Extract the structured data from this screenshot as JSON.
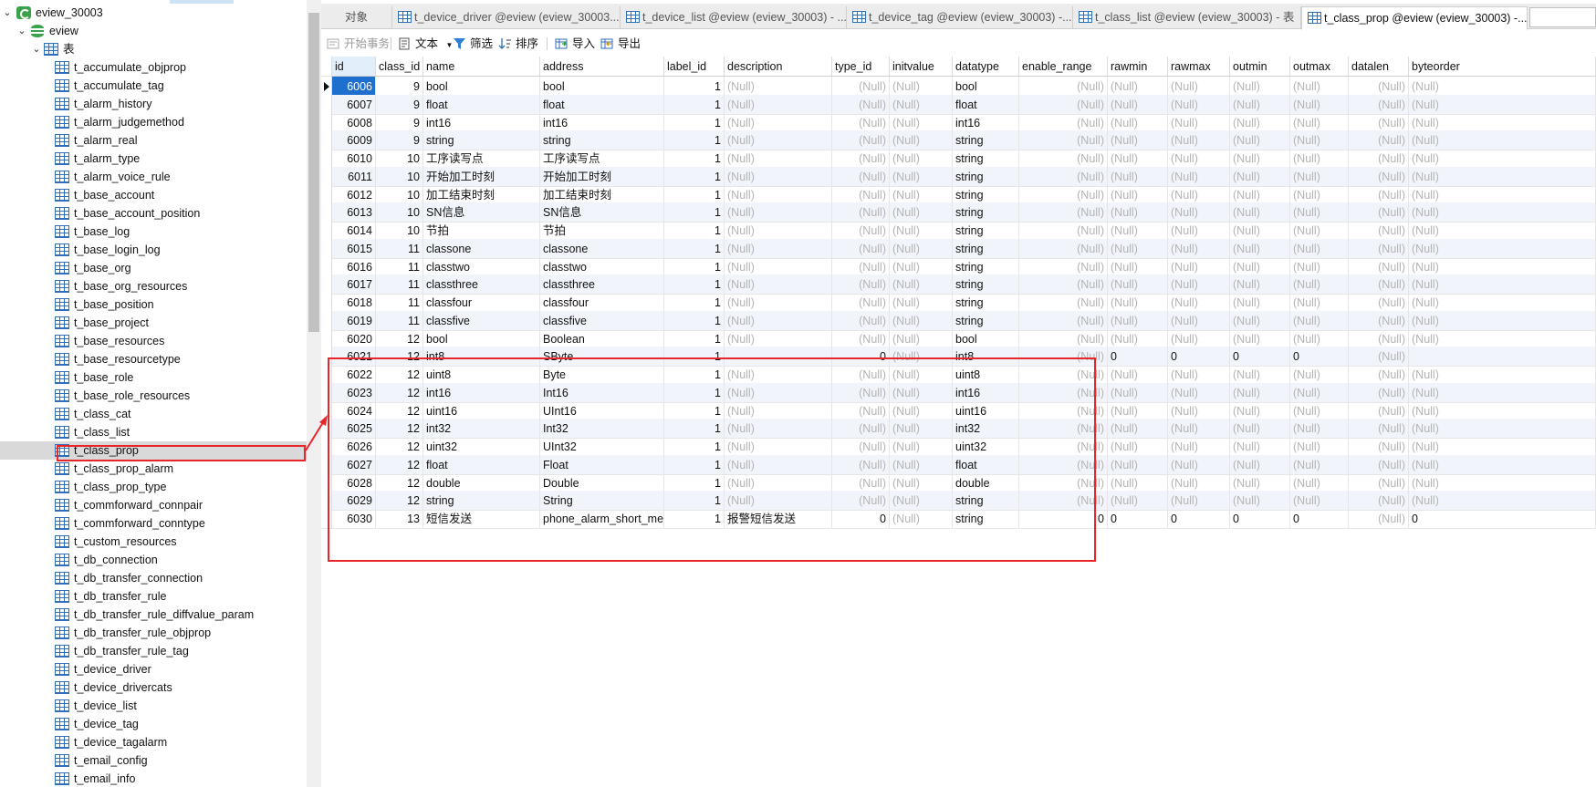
{
  "navigator": {
    "connection": "eview_30003",
    "database": "eview",
    "tables_folder": "表",
    "tables": [
      "t_accumulate_objprop",
      "t_accumulate_tag",
      "t_alarm_history",
      "t_alarm_judgemethod",
      "t_alarm_real",
      "t_alarm_type",
      "t_alarm_voice_rule",
      "t_base_account",
      "t_base_account_position",
      "t_base_log",
      "t_base_login_log",
      "t_base_org",
      "t_base_org_resources",
      "t_base_position",
      "t_base_project",
      "t_base_resources",
      "t_base_resourcetype",
      "t_base_role",
      "t_base_role_resources",
      "t_class_cat",
      "t_class_list",
      "t_class_prop",
      "t_class_prop_alarm",
      "t_class_prop_type",
      "t_commforward_connpair",
      "t_commforward_conntype",
      "t_custom_resources",
      "t_db_connection",
      "t_db_transfer_connection",
      "t_db_transfer_rule",
      "t_db_transfer_rule_diffvalue_param",
      "t_db_transfer_rule_objprop",
      "t_db_transfer_rule_tag",
      "t_device_driver",
      "t_device_drivercats",
      "t_device_list",
      "t_device_tag",
      "t_device_tagalarm",
      "t_email_config",
      "t_email_info"
    ],
    "selected_table": "t_class_prop"
  },
  "tabs": [
    {
      "label": "对象",
      "icon": "none"
    },
    {
      "label": "t_device_driver @eview (eview_30003...",
      "icon": "table-icon"
    },
    {
      "label": "t_device_list @eview (eview_30003) - ...",
      "icon": "table-icon"
    },
    {
      "label": "t_device_tag @eview (eview_30003) -...",
      "icon": "table-icon"
    },
    {
      "label": "t_class_list @eview (eview_30003) - 表",
      "icon": "table-icon"
    },
    {
      "label": "t_class_prop @eview (eview_30003) -...",
      "icon": "table-icon"
    }
  ],
  "toolbar": {
    "begin_transaction": "开始事务",
    "text": "文本",
    "filter": "筛选",
    "sort": "排序",
    "import": "导入",
    "export": "导出"
  },
  "grid": {
    "columns": [
      "id",
      "class_id",
      "name",
      "address",
      "label_id",
      "description",
      "type_id",
      "initvalue",
      "datatype",
      "enable_range",
      "rawmin",
      "rawmax",
      "outmin",
      "outmax",
      "datalen",
      "byteorder"
    ],
    "null_text": "(Null)",
    "rows": [
      [
        "6006",
        "9",
        "bool",
        "bool",
        "1",
        "(Null)",
        "(Null)",
        "(Null)",
        "bool",
        "(Null)",
        "(Null)",
        "(Null)",
        "(Null)",
        "(Null)",
        "(Null)",
        "(Null)"
      ],
      [
        "6007",
        "9",
        "float",
        "float",
        "1",
        "(Null)",
        "(Null)",
        "(Null)",
        "float",
        "(Null)",
        "(Null)",
        "(Null)",
        "(Null)",
        "(Null)",
        "(Null)",
        "(Null)"
      ],
      [
        "6008",
        "9",
        "int16",
        "int16",
        "1",
        "(Null)",
        "(Null)",
        "(Null)",
        "int16",
        "(Null)",
        "(Null)",
        "(Null)",
        "(Null)",
        "(Null)",
        "(Null)",
        "(Null)"
      ],
      [
        "6009",
        "9",
        "string",
        "string",
        "1",
        "(Null)",
        "(Null)",
        "(Null)",
        "string",
        "(Null)",
        "(Null)",
        "(Null)",
        "(Null)",
        "(Null)",
        "(Null)",
        "(Null)"
      ],
      [
        "6010",
        "10",
        "工序读写点",
        "工序读写点",
        "1",
        "(Null)",
        "(Null)",
        "(Null)",
        "string",
        "(Null)",
        "(Null)",
        "(Null)",
        "(Null)",
        "(Null)",
        "(Null)",
        "(Null)"
      ],
      [
        "6011",
        "10",
        "开始加工时刻",
        "开始加工时刻",
        "1",
        "(Null)",
        "(Null)",
        "(Null)",
        "string",
        "(Null)",
        "(Null)",
        "(Null)",
        "(Null)",
        "(Null)",
        "(Null)",
        "(Null)"
      ],
      [
        "6012",
        "10",
        "加工结束时刻",
        "加工结束时刻",
        "1",
        "(Null)",
        "(Null)",
        "(Null)",
        "string",
        "(Null)",
        "(Null)",
        "(Null)",
        "(Null)",
        "(Null)",
        "(Null)",
        "(Null)"
      ],
      [
        "6013",
        "10",
        "SN信息",
        "SN信息",
        "1",
        "(Null)",
        "(Null)",
        "(Null)",
        "string",
        "(Null)",
        "(Null)",
        "(Null)",
        "(Null)",
        "(Null)",
        "(Null)",
        "(Null)"
      ],
      [
        "6014",
        "10",
        "节拍",
        "节拍",
        "1",
        "(Null)",
        "(Null)",
        "(Null)",
        "string",
        "(Null)",
        "(Null)",
        "(Null)",
        "(Null)",
        "(Null)",
        "(Null)",
        "(Null)"
      ],
      [
        "6015",
        "11",
        "classone",
        "classone",
        "1",
        "(Null)",
        "(Null)",
        "(Null)",
        "string",
        "(Null)",
        "(Null)",
        "(Null)",
        "(Null)",
        "(Null)",
        "(Null)",
        "(Null)"
      ],
      [
        "6016",
        "11",
        "classtwo",
        "classtwo",
        "1",
        "(Null)",
        "(Null)",
        "(Null)",
        "string",
        "(Null)",
        "(Null)",
        "(Null)",
        "(Null)",
        "(Null)",
        "(Null)",
        "(Null)"
      ],
      [
        "6017",
        "11",
        "classthree",
        "classthree",
        "1",
        "(Null)",
        "(Null)",
        "(Null)",
        "string",
        "(Null)",
        "(Null)",
        "(Null)",
        "(Null)",
        "(Null)",
        "(Null)",
        "(Null)"
      ],
      [
        "6018",
        "11",
        "classfour",
        "classfour",
        "1",
        "(Null)",
        "(Null)",
        "(Null)",
        "string",
        "(Null)",
        "(Null)",
        "(Null)",
        "(Null)",
        "(Null)",
        "(Null)",
        "(Null)"
      ],
      [
        "6019",
        "11",
        "classfive",
        "classfive",
        "1",
        "(Null)",
        "(Null)",
        "(Null)",
        "string",
        "(Null)",
        "(Null)",
        "(Null)",
        "(Null)",
        "(Null)",
        "(Null)",
        "(Null)"
      ],
      [
        "6020",
        "12",
        "bool",
        "Boolean",
        "1",
        "(Null)",
        "(Null)",
        "(Null)",
        "bool",
        "(Null)",
        "(Null)",
        "(Null)",
        "(Null)",
        "(Null)",
        "(Null)",
        "(Null)"
      ],
      [
        "6021",
        "12",
        "int8",
        "SByte",
        "1",
        "",
        "0",
        "(Null)",
        "int8",
        "(Null)",
        "0",
        "0",
        "0",
        "0",
        "(Null)",
        ""
      ],
      [
        "6022",
        "12",
        "uint8",
        "Byte",
        "1",
        "(Null)",
        "(Null)",
        "(Null)",
        "uint8",
        "(Null)",
        "(Null)",
        "(Null)",
        "(Null)",
        "(Null)",
        "(Null)",
        "(Null)"
      ],
      [
        "6023",
        "12",
        "int16",
        "Int16",
        "1",
        "(Null)",
        "(Null)",
        "(Null)",
        "int16",
        "(Null)",
        "(Null)",
        "(Null)",
        "(Null)",
        "(Null)",
        "(Null)",
        "(Null)"
      ],
      [
        "6024",
        "12",
        "uint16",
        "UInt16",
        "1",
        "(Null)",
        "(Null)",
        "(Null)",
        "uint16",
        "(Null)",
        "(Null)",
        "(Null)",
        "(Null)",
        "(Null)",
        "(Null)",
        "(Null)"
      ],
      [
        "6025",
        "12",
        "int32",
        "Int32",
        "1",
        "(Null)",
        "(Null)",
        "(Null)",
        "int32",
        "(Null)",
        "(Null)",
        "(Null)",
        "(Null)",
        "(Null)",
        "(Null)",
        "(Null)"
      ],
      [
        "6026",
        "12",
        "uint32",
        "UInt32",
        "1",
        "(Null)",
        "(Null)",
        "(Null)",
        "uint32",
        "(Null)",
        "(Null)",
        "(Null)",
        "(Null)",
        "(Null)",
        "(Null)",
        "(Null)"
      ],
      [
        "6027",
        "12",
        "float",
        "Float",
        "1",
        "(Null)",
        "(Null)",
        "(Null)",
        "float",
        "(Null)",
        "(Null)",
        "(Null)",
        "(Null)",
        "(Null)",
        "(Null)",
        "(Null)"
      ],
      [
        "6028",
        "12",
        "double",
        "Double",
        "1",
        "(Null)",
        "(Null)",
        "(Null)",
        "double",
        "(Null)",
        "(Null)",
        "(Null)",
        "(Null)",
        "(Null)",
        "(Null)",
        "(Null)"
      ],
      [
        "6029",
        "12",
        "string",
        "String",
        "1",
        "(Null)",
        "(Null)",
        "(Null)",
        "string",
        "(Null)",
        "(Null)",
        "(Null)",
        "(Null)",
        "(Null)",
        "(Null)",
        "(Null)"
      ],
      [
        "6030",
        "13",
        "短信发送",
        "phone_alarm_short_mess",
        "1",
        "报警短信发送",
        "0",
        "(Null)",
        "string",
        "0",
        "0",
        "0",
        "0",
        "0",
        "(Null)",
        "0"
      ]
    ],
    "current_row_id": "6006"
  },
  "colors": {
    "annotation_red": "#e8262a",
    "selection_blue": "#1f6fcf",
    "alt_row": "#f1f5fb",
    "null_gray": "#b4b4b4"
  }
}
